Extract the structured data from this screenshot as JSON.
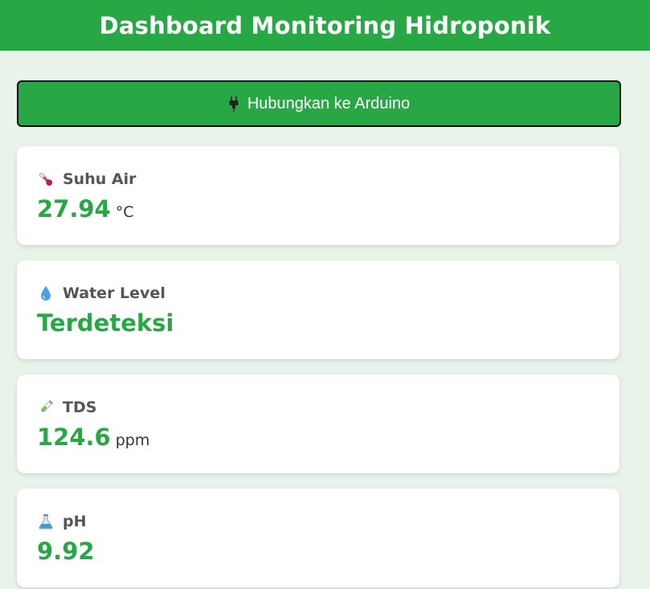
{
  "header": {
    "title": "Dashboard Monitoring Hidroponik"
  },
  "connect_button": {
    "label": "Hubungkan ke Arduino",
    "icon": "plug-icon"
  },
  "cards": [
    {
      "label": "Suhu Air",
      "value": "27.94",
      "unit": "°C",
      "icon": "thermometer-icon"
    },
    {
      "label": "Water Level",
      "value": "Terdeteksi",
      "unit": "",
      "icon": "water-drop-icon"
    },
    {
      "label": "TDS",
      "value": "124.6",
      "unit": "ppm",
      "icon": "test-tube-icon"
    },
    {
      "label": "pH",
      "value": "9.92",
      "unit": "",
      "icon": "flask-icon"
    }
  ],
  "colors": {
    "primary": "#28a745",
    "background": "#e9f3ea",
    "card": "#ffffff",
    "label": "#555555"
  }
}
